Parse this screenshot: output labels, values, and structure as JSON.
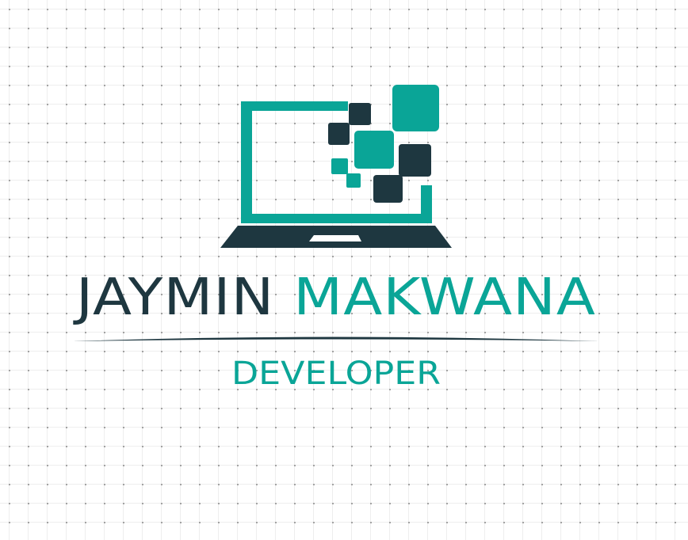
{
  "logo": {
    "name_first": "JAYMIN",
    "name_last": "MAKWANA",
    "subtitle": "DEVELOPER",
    "colors": {
      "dark": "#1e3740",
      "teal": "#0aa597",
      "background": "#ffffff",
      "grid_dot": "#9a9a9a"
    },
    "icon": "laptop-pixel-icon"
  }
}
